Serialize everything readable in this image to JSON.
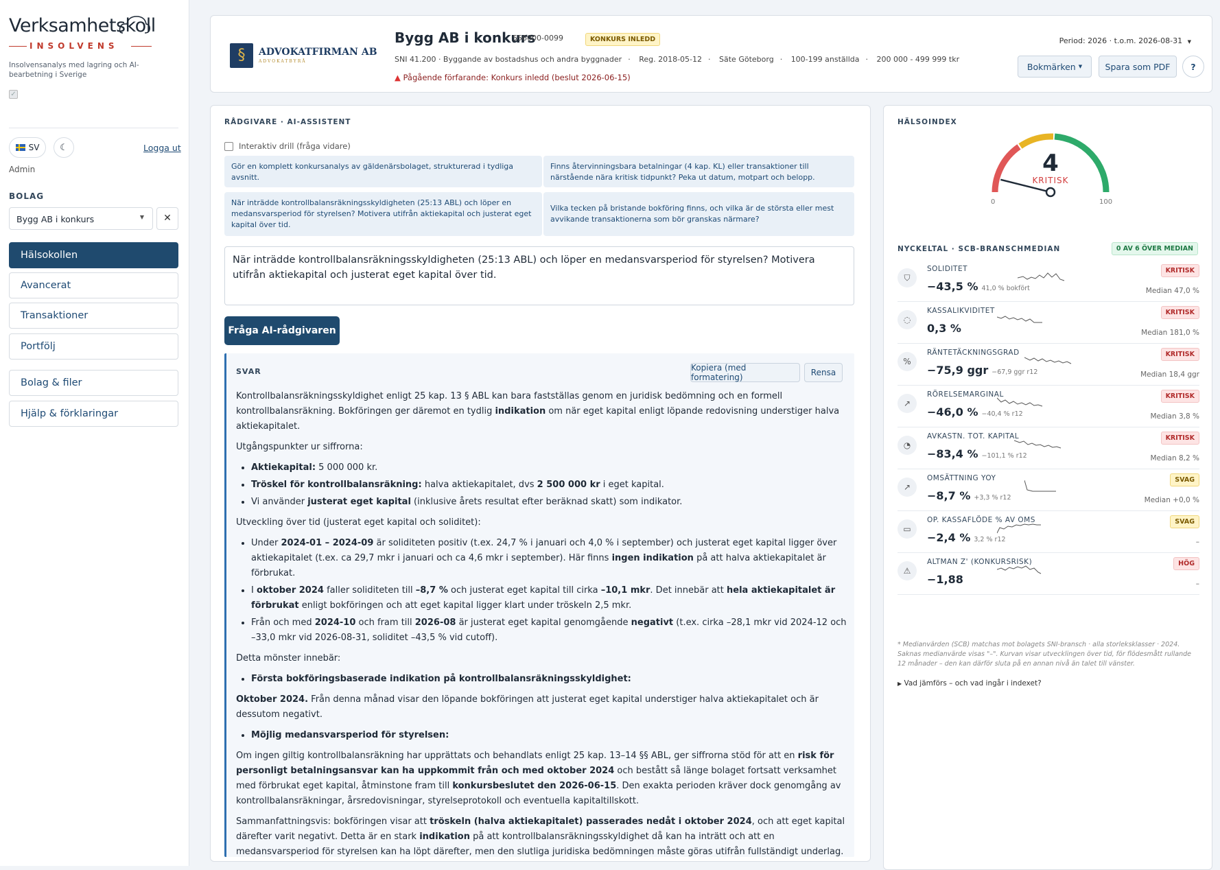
{
  "sidebar": {
    "logo_main": "Verksamhetskoll",
    "logo_sub": "INSOLVENS",
    "tagline": "Insolvensanalys med lagring och AI-bearbetning i Sverige",
    "lang": "SV",
    "logout": "Logga ut",
    "role": "Admin",
    "company_heading": "BOLAG",
    "company_selected": "Bygg AB i konkurs",
    "nav": [
      {
        "label": "Hälsokollen",
        "active": true
      },
      {
        "label": "Avancerat"
      },
      {
        "label": "Transaktioner"
      },
      {
        "label": "Portfölj"
      },
      {
        "label": "Bolag & filer"
      },
      {
        "label": "Hjälp & förklaringar"
      }
    ]
  },
  "header": {
    "firm_name": "ADVOKATFIRMAN AB",
    "firm_sub": "ADVOKATBYRÅ",
    "company": "Bygg AB i konkurs",
    "org_nr": "556000-0099",
    "status_badge": "KONKURS INLEDD",
    "meta": [
      "SNI 41.200 · Byggande av bostadshus och andra byggnader",
      "Reg. 2018-05-12",
      "Säte Göteborg",
      "100-199 anställda",
      "200 000 - 499 999 tkr"
    ],
    "procedure": "Pågående förfarande: Konkurs inledd (beslut 2026-06-15)",
    "period": "Period: 2026 · t.o.m. 2026-08-31",
    "bookmarks": "Bokmärken",
    "save_pdf": "Spara som PDF",
    "help": "?"
  },
  "advisor": {
    "heading": "RÅDGIVARE · AI-ASSISTENT",
    "drill_label": "Interaktiv drill (fråga vidare)",
    "suggestions": [
      "Gör en komplett konkursanalys av gäldenärsbolaget, strukturerad i tydliga avsnitt.",
      "Finns återvinningsbara betalningar (4 kap. KL) eller transaktioner till närstående nära kritisk tidpunkt? Peka ut datum, motpart och belopp.",
      "När inträdde kontrollbalansräkningsskyldigheten (25:13 ABL) och löper en medansvarsperiod för styrelsen? Motivera utifrån aktiekapital och justerat eget kapital över tid.",
      "Vilka tecken på bristande bokföring finns, och vilka är de största eller mest avvikande transaktionerna som bör granskas närmare?"
    ],
    "question": "När inträdde kontrollbalansräkningsskyldigheten (25:13 ABL) och löper en medansvarsperiod för styrelsen? Motivera utifrån aktiekapital och justerat eget kapital över tid.",
    "ask_button": "Fråga AI-rådgivaren",
    "answer_heading": "SVAR",
    "copy_button": "Kopiera (med formatering)",
    "clear_button": "Rensa"
  },
  "health": {
    "heading": "HÄLSOINDEX",
    "score": "4",
    "score_label": "KRITISK",
    "score_value": 4,
    "scale_min": "0",
    "scale_max": "100",
    "kpi_heading": "NYCKELTAL · SCB-BRANSCHMEDIAN",
    "kpi_badge": "0 AV 6 ÖVER MEDIAN",
    "kpis": [
      {
        "name": "SOLIDITET",
        "value": "−43,5 %",
        "sub": "41,0 % bokfört",
        "badge": "KRITISK",
        "median": "Median 47,0 %",
        "icon": "shield-icon",
        "glyph": "⛉",
        "level": "red"
      },
      {
        "name": "KASSALIKVIDITET",
        "value": "0,3 %",
        "sub": "",
        "badge": "KRITISK",
        "median": "Median 181,0 %",
        "icon": "drop-icon",
        "glyph": "◌",
        "level": "red"
      },
      {
        "name": "RÄNTETÄCKNINGSGRAD",
        "value": "−75,9 ggr",
        "sub": "−67,9 ggr r12",
        "badge": "KRITISK",
        "median": "Median 18,4 ggr",
        "icon": "percent-icon",
        "glyph": "%",
        "level": "red"
      },
      {
        "name": "RÖRELSEMARGINAL",
        "value": "−46,0 %",
        "sub": "−40,4 % r12",
        "badge": "KRITISK",
        "median": "Median 3,8 %",
        "icon": "trend-icon",
        "glyph": "↗",
        "level": "red"
      },
      {
        "name": "AVKASTN. TOT. KAPITAL",
        "value": "−83,4 %",
        "sub": "−101,1 % r12",
        "badge": "KRITISK",
        "median": "Median 8,2 %",
        "icon": "gauge-icon",
        "glyph": "◔",
        "level": "red"
      },
      {
        "name": "OMSÄTTNING YOY",
        "value": "−8,7 %",
        "sub": "+3,3 % r12",
        "badge": "SVAG",
        "median": "Median +0,0 %",
        "icon": "trend-up-icon",
        "glyph": "↗",
        "level": "yellow"
      },
      {
        "name": "OP. KASSAFLÖDE % AV OMS",
        "value": "−2,4 %",
        "sub": "3,2 % r12",
        "badge": "SVAG",
        "median": "–",
        "icon": "cash-icon",
        "glyph": "▭",
        "level": "yellow"
      },
      {
        "name": "ALTMAN Z' (KONKURSRISK)",
        "value": "−1,88",
        "sub": "",
        "badge": "HÖG",
        "median": "–",
        "icon": "warning-icon",
        "glyph": "⚠",
        "level": "red"
      }
    ],
    "footnote": "* Medianvärden (SCB) matchas mot bolagets SNI-bransch · alla storleksklasser · 2024. Saknas medianvärde visas \"–\". Kurvan visar utvecklingen över tid, för flödesmått rullande 12 månader – den kan därför sluta på en annan nivå än talet till vänster.",
    "details": "Vad jämförs – och vad ingår i indexet?"
  }
}
